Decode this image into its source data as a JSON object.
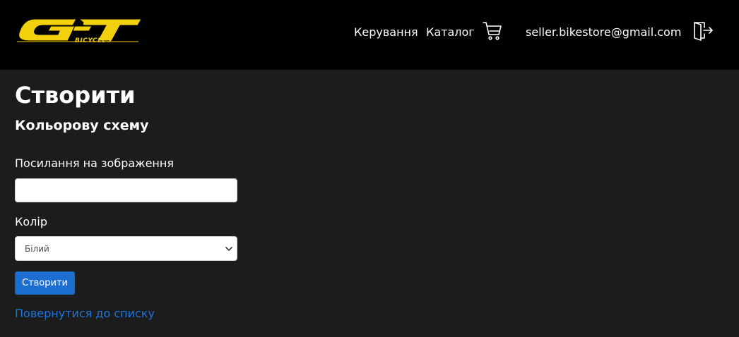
{
  "brand": {
    "logo_text": "GT",
    "logo_subtext": "BICYCLES",
    "logo_color": "#f2d00c"
  },
  "nav": {
    "manage": "Керування",
    "catalog": "Каталог",
    "cart_icon": "cart-icon",
    "user_email": "seller.bikestore@gmail.com",
    "logout_icon": "logout-icon"
  },
  "page": {
    "title": "Створити",
    "subtitle": "Кольорову схему"
  },
  "form": {
    "image_label": "Посилання на зображення",
    "image_value": "",
    "color_label": "Колір",
    "color_selected": "Білий",
    "submit_label": "Створити"
  },
  "links": {
    "back": "Повернутися до списку"
  },
  "colors": {
    "background": "#1c1c1c",
    "navbar": "#000000",
    "primary_button": "#1c6fd0",
    "link": "#1f74da"
  }
}
